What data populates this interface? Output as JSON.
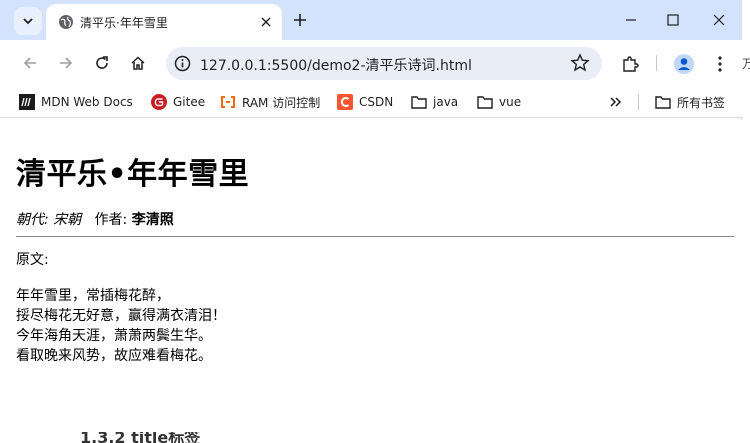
{
  "tab": {
    "title": "清平乐·年年雪里"
  },
  "toolbar": {
    "url": "127.0.0.1:5500/demo2-清平乐诗词.html",
    "edge_char": "万"
  },
  "bookmarks": {
    "items": [
      {
        "label": "MDN Web Docs"
      },
      {
        "label": "Gitee"
      },
      {
        "label": "RAM 访问控制"
      },
      {
        "label": "CSDN"
      },
      {
        "label": "java"
      },
      {
        "label": "vue"
      }
    ],
    "all_label": "所有书签"
  },
  "page": {
    "title": "清平乐•年年雪里",
    "dynasty": "朝代: 宋朝",
    "author_label": "作者:",
    "author": "李清照",
    "original_label": "原文:",
    "lines": [
      "年年雪里，常插梅花醉，",
      "挼尽梅花无好意，赢得满衣清泪！",
      "今年海角天涯，萧萧两鬓生华。",
      "看取晚来风势，故应难看梅花。"
    ]
  },
  "behind_text": "1.3.2 title标签",
  "colors": {
    "titlebar": "#d3e3fd",
    "omnibox": "#e9eef6",
    "accent": "#0b57d0"
  }
}
